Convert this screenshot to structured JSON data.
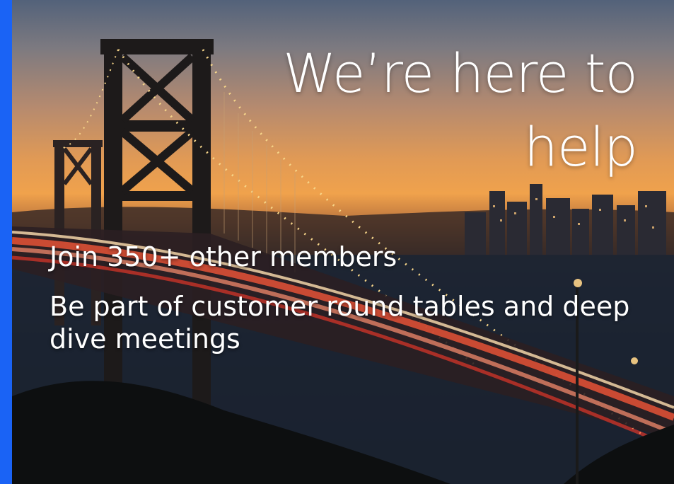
{
  "slide": {
    "headline_line1": "We’re here to",
    "headline_line2": "help",
    "bullets": [
      "Join 350+ other members",
      "Be part of customer round tables and deep dive meetings"
    ],
    "background_image": "bridge-at-dusk-photo"
  },
  "colors": {
    "accent_bar": "#1a63f5",
    "text": "#ffffff",
    "sky_top": "#53627a",
    "sky_horizon": "#f0a24c"
  }
}
